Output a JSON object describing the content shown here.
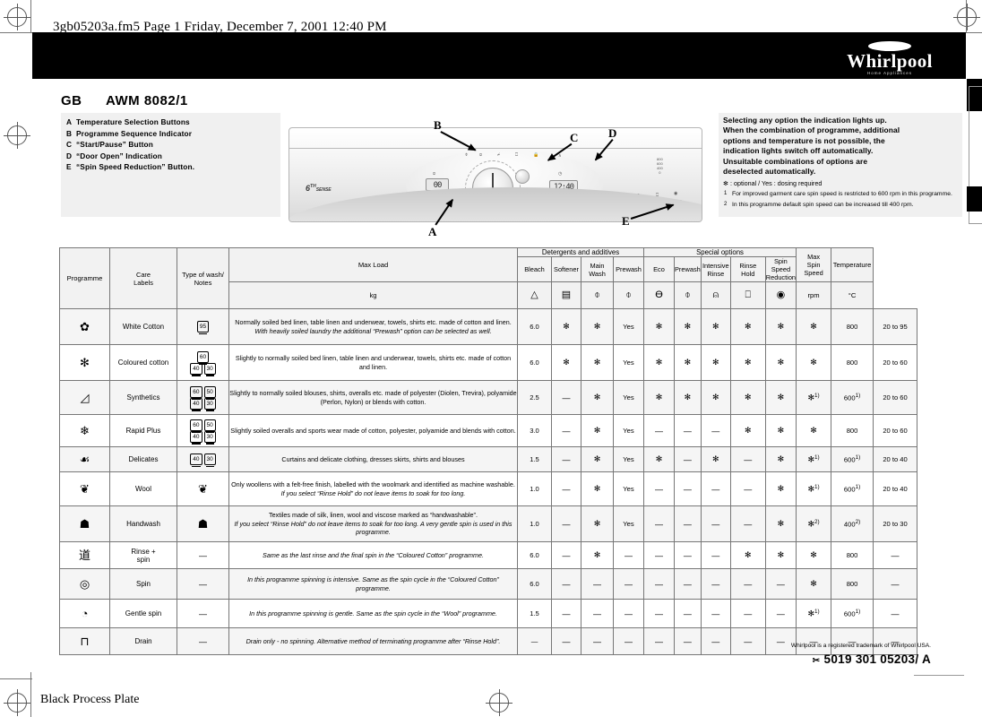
{
  "page_header": "3gb05203a.fm5  Page 1  Friday, December 7, 2001  12:40 PM",
  "brand": {
    "name": "Whirlpool",
    "tagline": "Home Appliances"
  },
  "model": {
    "country": "GB",
    "name": "AWM 8082/1"
  },
  "legend": {
    "items": [
      {
        "letter": "A",
        "text": "Temperature Selection Buttons"
      },
      {
        "letter": "B",
        "text": "Programme Sequence Indicator"
      },
      {
        "letter": "C",
        "text": "“Start/Pause” Button"
      },
      {
        "letter": "D",
        "text": "“Door Open” Indication"
      },
      {
        "letter": "E",
        "text": "“Spin Speed Reduction” Button."
      }
    ]
  },
  "panel_callouts": [
    "A",
    "B",
    "C",
    "D",
    "E"
  ],
  "panel_display": {
    "temp": "00",
    "time": "12:40"
  },
  "notes": {
    "bold_lines": [
      "Selecting any option the indication lights up.",
      "When the combination of programme, additional",
      "options and temperature is not possible, the",
      "indication lights switch off automatically.",
      "Unsuitable combinations of options are",
      "deselected automatically."
    ],
    "optional_line": "✻ : optional / Yes : dosing required",
    "footnotes": [
      {
        "num": "1",
        "text": "For improved garment care spin speed is restricted to 600 rpm in this programme."
      },
      {
        "num": "2",
        "text": "In this programme default spin speed can be increased till 400 rpm."
      }
    ]
  },
  "table": {
    "headers": {
      "programme": "Programme",
      "care_labels": "Care\nLabels",
      "type_notes": "Type of wash/ Notes",
      "max_load": "Max Load",
      "max_load_unit": "kg",
      "detergents_group": "Detergents and additives",
      "special_group": "Special options",
      "bleach": "Bleach",
      "softener": "Softener",
      "main_wash": "Main Wash",
      "prewash": "Prewash",
      "eco": "Eco",
      "prewash2": "Prewash",
      "intensive_rinse": "Intensive Rinse",
      "rinse_hold": "Rinse Hold",
      "spin_speed_reduction": "Spin Speed Reduction",
      "max_spin_speed": "Max Spin Speed",
      "max_spin_speed_unit": "rpm",
      "temperature": "Temperature",
      "temperature_unit": "°C"
    },
    "rows": [
      {
        "programme": "White Cotton",
        "prog_icon": "cotton-icon",
        "care_labels": [
          "95"
        ],
        "care_labels_row2": [],
        "care_icon": "",
        "notes": "Normally soiled bed linen, table linen and underwear, towels, shirts etc. made of cotton and linen.",
        "notes_italic": "With heavily soiled laundry the additional “Prewash” option can be selected as well.",
        "max_load": "6.0",
        "bleach": "✻",
        "softener": "✻",
        "main_wash": "Yes",
        "prewash": "✻",
        "eco": "✻",
        "prewash2": "✻",
        "intensive_rinse": "✻",
        "rinse_hold": "✻",
        "spin_reduction": "✻",
        "spin_reduction_note": "",
        "max_spin": "800",
        "max_spin_note": "",
        "temperature": "20 to 95"
      },
      {
        "programme": "Coloured cotton",
        "prog_icon": "coloured-cotton-icon",
        "care_labels": [
          "60"
        ],
        "care_labels_row2": [
          "40",
          "30"
        ],
        "care_icon": "",
        "notes": "Slightly to normally soiled bed linen, table linen and underwear, towels, shirts etc. made of cotton and linen.",
        "notes_italic": "",
        "max_load": "6.0",
        "bleach": "✻",
        "softener": "✻",
        "main_wash": "Yes",
        "prewash": "✻",
        "eco": "✻",
        "prewash2": "✻",
        "intensive_rinse": "✻",
        "rinse_hold": "✻",
        "spin_reduction": "✻",
        "spin_reduction_note": "",
        "max_spin": "800",
        "max_spin_note": "",
        "temperature": "20 to 60"
      },
      {
        "programme": "Synthetics",
        "prog_icon": "synthetics-icon",
        "care_labels": [
          "60",
          "50"
        ],
        "care_labels_row2": [
          "40",
          "30"
        ],
        "care_icon": "",
        "notes": "Slightly to normally soiled blouses, shirts, overalls etc. made of polyester (Diolen, Trevira), polyamide (Perlon, Nylon) or blends with cotton.",
        "notes_italic": "",
        "max_load": "2.5",
        "bleach": "—",
        "softener": "✻",
        "main_wash": "Yes",
        "prewash": "✻",
        "eco": "✻",
        "prewash2": "✻",
        "intensive_rinse": "✻",
        "rinse_hold": "✻",
        "spin_reduction": "✻",
        "spin_reduction_note": "1)",
        "max_spin": "600",
        "max_spin_note": "1)",
        "temperature": "20 to 60"
      },
      {
        "programme": "Rapid Plus",
        "prog_icon": "rapid-plus-icon",
        "care_labels": [
          "60",
          "50"
        ],
        "care_labels_row2": [
          "40",
          "30"
        ],
        "care_icon": "",
        "notes": "Slightly soiled overalls and sports wear made of cotton, polyester, polyamide and blends with cotton.",
        "notes_italic": "",
        "max_load": "3.0",
        "bleach": "—",
        "softener": "✻",
        "main_wash": "Yes",
        "prewash": "—",
        "eco": "—",
        "prewash2": "—",
        "intensive_rinse": "✻",
        "rinse_hold": "✻",
        "spin_reduction": "✻",
        "spin_reduction_note": "",
        "max_spin": "800",
        "max_spin_note": "",
        "temperature": "20 to 60"
      },
      {
        "programme": "Delicates",
        "prog_icon": "delicates-icon",
        "care_labels": [
          "40",
          "30"
        ],
        "care_labels_row2": [],
        "care_icon": "",
        "notes": "Curtains and delicate clothing, dresses skirts, shirts and blouses",
        "notes_italic": "",
        "max_load": "1.5",
        "bleach": "—",
        "softener": "✻",
        "main_wash": "Yes",
        "prewash": "✻",
        "eco": "—",
        "prewash2": "✻",
        "intensive_rinse": "—",
        "rinse_hold": "✻",
        "spin_reduction": "✻",
        "spin_reduction_note": "1)",
        "max_spin": "600",
        "max_spin_note": "1)",
        "temperature": "20 to 40"
      },
      {
        "programme": "Wool",
        "prog_icon": "wool-icon",
        "care_labels": [],
        "care_labels_row2": [],
        "care_icon": "wool-care-icon",
        "notes": "Only woollens with a felt-free finish, labelled with the woolmark and identified as machine washable.",
        "notes_italic": "If you select “Rinse Hold” do not leave items to soak for too long.",
        "max_load": "1.0",
        "bleach": "—",
        "softener": "✻",
        "main_wash": "Yes",
        "prewash": "—",
        "eco": "—",
        "prewash2": "—",
        "intensive_rinse": "—",
        "rinse_hold": "✻",
        "spin_reduction": "✻",
        "spin_reduction_note": "1)",
        "max_spin": "600",
        "max_spin_note": "1)",
        "temperature": "20 to 40"
      },
      {
        "programme": "Handwash",
        "prog_icon": "handwash-icon",
        "care_labels": [],
        "care_labels_row2": [],
        "care_icon": "handwash-care-icon",
        "notes": "Textiles made of silk, linen, wool and viscose marked as “handwashable”.",
        "notes_italic": "If you select “Rinse Hold” do not leave items to soak for too long. A very gentle spin is used in this programme.",
        "max_load": "1.0",
        "bleach": "—",
        "softener": "✻",
        "main_wash": "Yes",
        "prewash": "—",
        "eco": "—",
        "prewash2": "—",
        "intensive_rinse": "—",
        "rinse_hold": "✻",
        "spin_reduction": "✻",
        "spin_reduction_note": "2)",
        "max_spin": "400",
        "max_spin_note": "2)",
        "temperature": "20 to 30"
      },
      {
        "programme": "Rinse +\nspin",
        "prog_icon": "rinse-spin-icon",
        "care_labels": [],
        "care_labels_row2": [],
        "care_icon": "dash",
        "notes": "",
        "notes_italic": "Same as the last rinse and the final spin in the “Coloured Cotton” programme.",
        "max_load": "6.0",
        "bleach": "—",
        "softener": "✻",
        "main_wash": "—",
        "prewash": "—",
        "eco": "—",
        "prewash2": "—",
        "intensive_rinse": "✻",
        "rinse_hold": "✻",
        "spin_reduction": "✻",
        "spin_reduction_note": "",
        "max_spin": "800",
        "max_spin_note": "",
        "temperature": "—"
      },
      {
        "programme": "Spin",
        "prog_icon": "spin-icon",
        "care_labels": [],
        "care_labels_row2": [],
        "care_icon": "dash",
        "notes": "",
        "notes_italic": "In this programme spinning is intensive. Same as the spin cycle in the “Coloured Cotton” programme.",
        "max_load": "6.0",
        "bleach": "—",
        "softener": "—",
        "main_wash": "—",
        "prewash": "—",
        "eco": "—",
        "prewash2": "—",
        "intensive_rinse": "—",
        "rinse_hold": "—",
        "spin_reduction": "✻",
        "spin_reduction_note": "",
        "max_spin": "800",
        "max_spin_note": "",
        "temperature": "—"
      },
      {
        "programme": "Gentle spin",
        "prog_icon": "gentle-spin-icon",
        "care_labels": [],
        "care_labels_row2": [],
        "care_icon": "dash",
        "notes": "",
        "notes_italic": "In this programme spinning is gentle. Same as the spin cycle in the “Wool” programme.",
        "max_load": "1.5",
        "bleach": "—",
        "softener": "—",
        "main_wash": "—",
        "prewash": "—",
        "eco": "—",
        "prewash2": "—",
        "intensive_rinse": "—",
        "rinse_hold": "—",
        "spin_reduction": "✻",
        "spin_reduction_note": "1)",
        "max_spin": "600",
        "max_spin_note": "1)",
        "temperature": "—"
      },
      {
        "programme": "Drain",
        "prog_icon": "drain-icon",
        "care_labels": [],
        "care_labels_row2": [],
        "care_icon": "dash",
        "notes": "",
        "notes_italic": "Drain only - no spinning. Alternative method of terminating programme after “Rinse Hold”.",
        "max_load": "—",
        "bleach": "—",
        "softener": "—",
        "main_wash": "—",
        "prewash": "—",
        "eco": "—",
        "prewash2": "—",
        "intensive_rinse": "—",
        "rinse_hold": "—",
        "spin_reduction": "—",
        "spin_reduction_note": "",
        "max_spin": "—",
        "max_spin_note": "",
        "temperature": "—"
      }
    ]
  },
  "footer": {
    "trademark": "Whirlpool is a registered trademark of Whirlpool USA.",
    "code": "5019 301 05203/ A",
    "process_plate": "Black Process Plate"
  }
}
